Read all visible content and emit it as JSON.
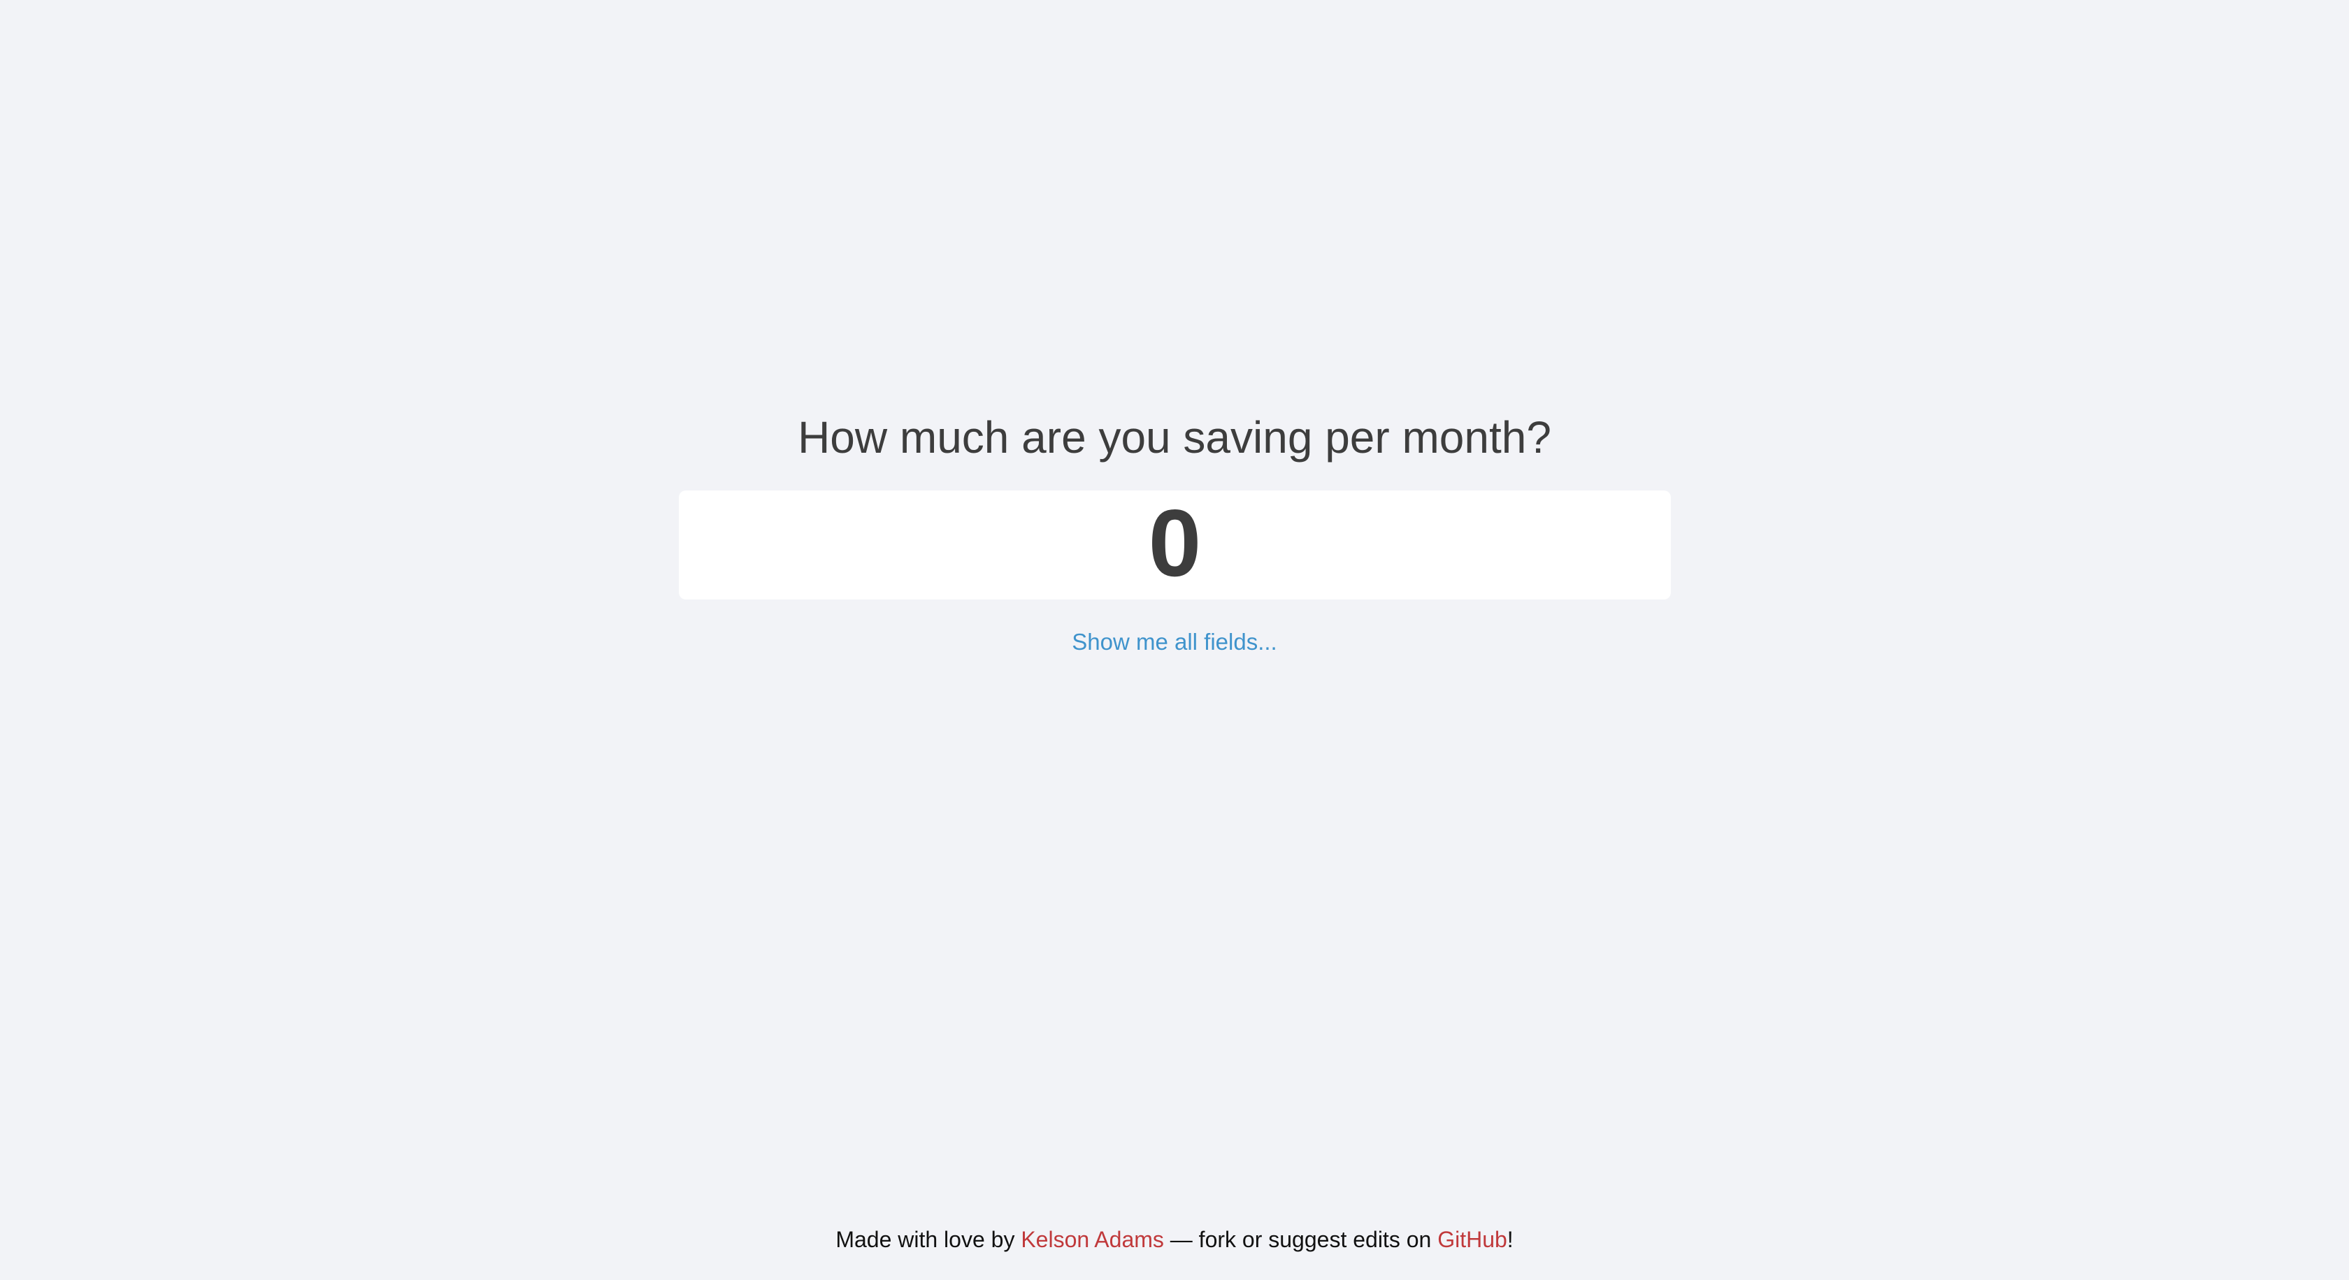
{
  "question": {
    "text": "How much are you saving per month?"
  },
  "savings_input": {
    "value": "0"
  },
  "show_all_link": {
    "label": "Show me all fields..."
  },
  "footer": {
    "prefix": "Made with love by ",
    "author_link": "Kelson Adams",
    "middle": " — fork or suggest edits on ",
    "github_link": "GitHub",
    "suffix": "!"
  },
  "colors": {
    "background": "#f2f3f7",
    "text": "#3d3d3d",
    "link_blue": "#3f93cc",
    "link_red": "#c0393b"
  }
}
